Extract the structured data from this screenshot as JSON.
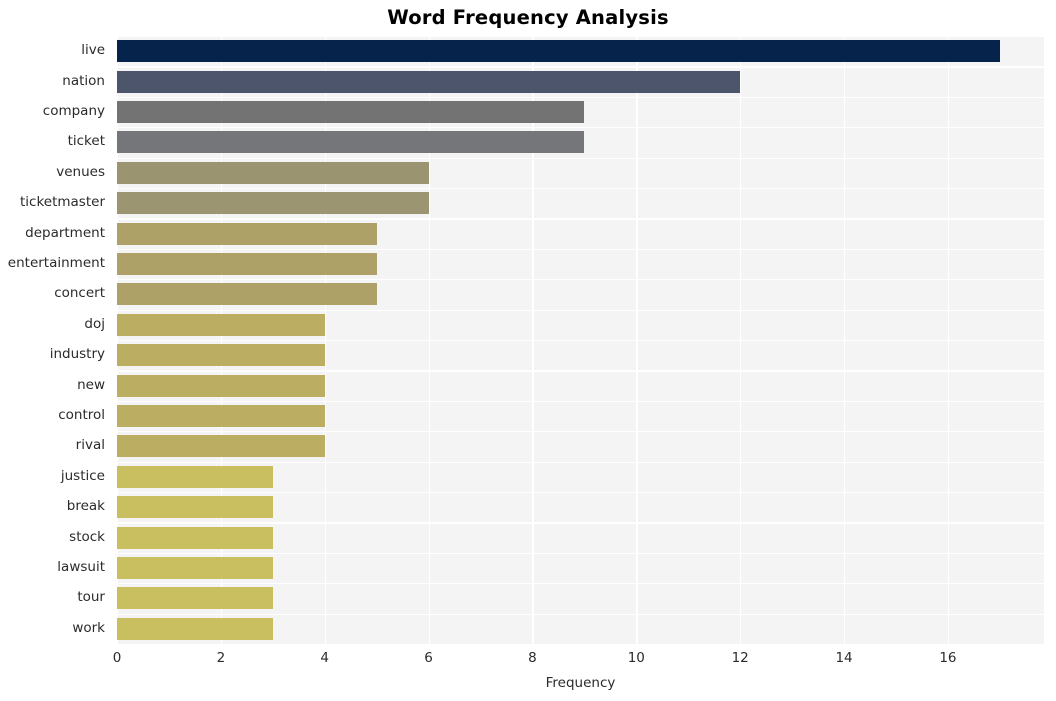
{
  "chart_data": {
    "type": "bar",
    "orientation": "horizontal",
    "title": "Word Frequency Analysis",
    "xlabel": "Frequency",
    "ylabel": "",
    "categories": [
      "live",
      "nation",
      "company",
      "ticket",
      "venues",
      "ticketmaster",
      "department",
      "entertainment",
      "concert",
      "doj",
      "industry",
      "new",
      "control",
      "rival",
      "justice",
      "break",
      "stock",
      "lawsuit",
      "tour",
      "work"
    ],
    "values": [
      17,
      12,
      9,
      9,
      6,
      6,
      5,
      5,
      5,
      4,
      4,
      4,
      4,
      4,
      3,
      3,
      3,
      3,
      3,
      3
    ],
    "bar_colors": [
      "#05234b",
      "#4d556c",
      "#737373",
      "#75767a",
      "#9a9471",
      "#9c9572",
      "#ada167",
      "#ada167",
      "#ada167",
      "#bbad62",
      "#bbad62",
      "#bbad62",
      "#bbad62",
      "#bbad62",
      "#cabf60",
      "#cabf60",
      "#cabf60",
      "#cabf60",
      "#cabf60",
      "#cabf60"
    ],
    "xlim": [
      0,
      17.85
    ],
    "xticks": [
      0,
      2,
      4,
      6,
      8,
      10,
      12,
      14,
      16
    ],
    "xtick_labels": [
      "0",
      "2",
      "4",
      "6",
      "8",
      "10",
      "12",
      "14",
      "16"
    ],
    "grid": true,
    "grid_color": "#ffffff",
    "plot_background": "#f4f4f4",
    "figure_background": "#ffffff",
    "legend": null,
    "title_color": "#000000",
    "tick_color": "#2b2b2b"
  }
}
